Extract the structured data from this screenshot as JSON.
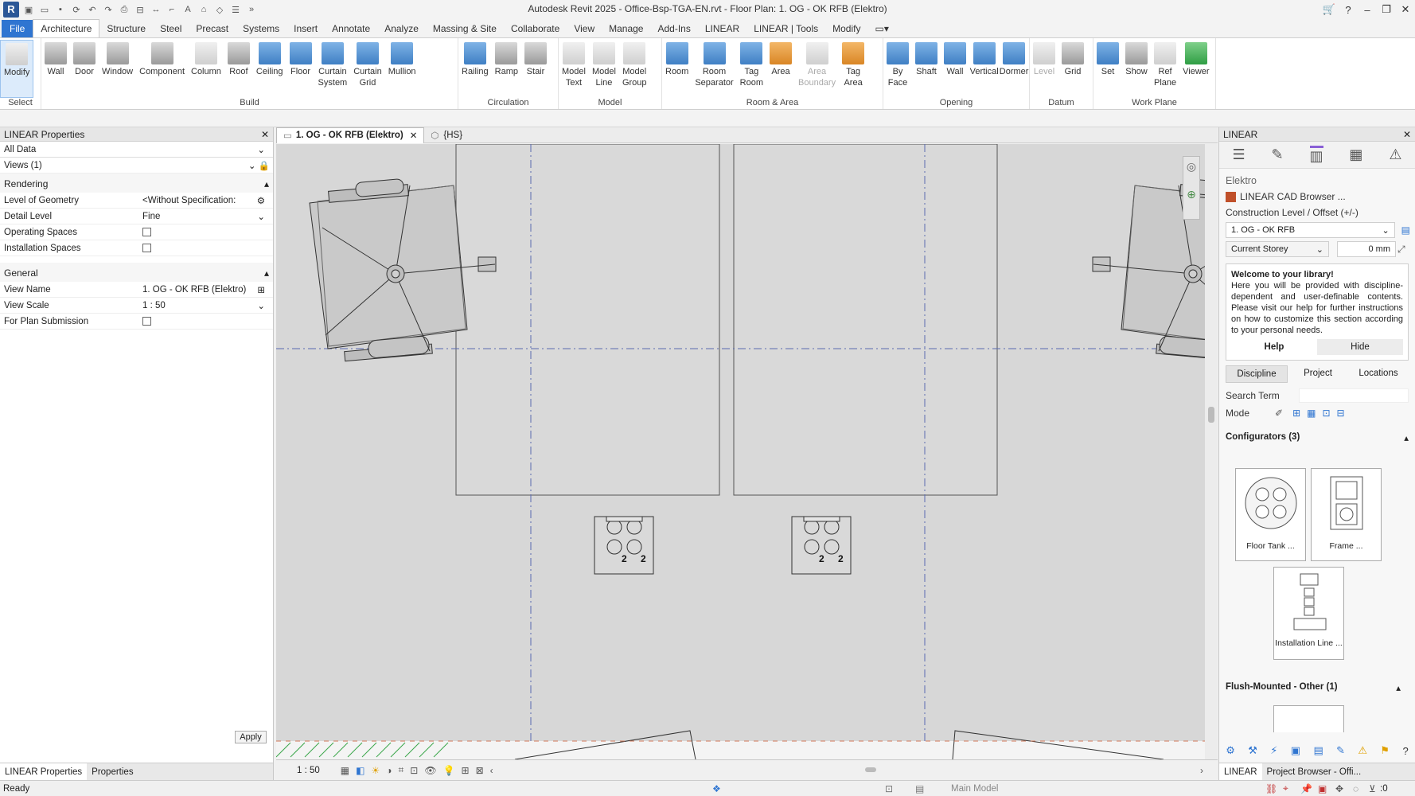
{
  "window": {
    "title": "Autodesk Revit 2025 - Office-Bsp-TGA-EN.rvt - Floor Plan: 1. OG - OK RFB (Elektro)"
  },
  "menu": [
    "File",
    "Architecture",
    "Structure",
    "Steel",
    "Precast",
    "Systems",
    "Insert",
    "Annotate",
    "Analyze",
    "Massing & Site",
    "Collaborate",
    "View",
    "Manage",
    "Add-Ins",
    "LINEAR",
    "LINEAR | Tools",
    "Modify"
  ],
  "ribbon": {
    "select_label": "Select",
    "modify": "Modify",
    "build": {
      "label": "Build",
      "tools": [
        "Wall",
        "Door",
        "Window",
        "Component",
        "Column",
        "Roof",
        "Ceiling",
        "Floor",
        "Curtain\nSystem",
        "Curtain\nGrid",
        "Mullion"
      ]
    },
    "circulation": {
      "label": "Circulation",
      "tools": [
        "Railing",
        "Ramp",
        "Stair"
      ]
    },
    "model": {
      "label": "Model",
      "tools": [
        "Model\nText",
        "Model\nLine",
        "Model\nGroup"
      ]
    },
    "roomarea": {
      "label": "Room & Area",
      "tools": [
        "Room",
        "Room\nSeparator",
        "Tag\nRoom",
        "Area",
        "Area\nBoundary",
        "Tag\nArea"
      ]
    },
    "opening": {
      "label": "Opening",
      "tools": [
        "By\nFace",
        "Shaft",
        "Wall",
        "Vertical",
        "Dormer"
      ]
    },
    "datum": {
      "label": "Datum",
      "tools": [
        "Level",
        "Grid"
      ]
    },
    "workplane": {
      "label": "Work Plane",
      "tools": [
        "Set",
        "Show",
        "Ref\nPlane",
        "Viewer"
      ]
    }
  },
  "properties": {
    "header": "LINEAR Properties",
    "filter": "All Data",
    "views": "Views (1)",
    "rendering_label": "Rendering",
    "level_of_geometry_k": "Level of Geometry",
    "level_of_geometry_v": "<Without Specification:",
    "detail_level_k": "Detail Level",
    "detail_level_v": "Fine",
    "operating_spaces": "Operating Spaces",
    "installation_spaces": "Installation Spaces",
    "general_label": "General",
    "view_name_k": "View Name",
    "view_name_v": "1. OG - OK RFB (Elektro)",
    "view_scale_k": "View Scale",
    "view_scale_v": "1 : 50",
    "plan_submission": "For Plan Submission",
    "apply": "Apply",
    "tab1": "LINEAR Properties",
    "tab2": "Properties"
  },
  "viewtabs": {
    "active": "1. OG - OK RFB (Elektro)",
    "other": "{HS}"
  },
  "canvas": {
    "tank_labels": [
      "2",
      "2"
    ]
  },
  "viewctl": {
    "scale": "1 : 50"
  },
  "linear": {
    "header": "LINEAR",
    "discipline": "Elektro",
    "cad_browser": "LINEAR CAD Browser ...",
    "level_label": "Construction Level / Offset (+/-)",
    "level_value": "1. OG - OK RFB",
    "storey": "Current Storey",
    "offset": "0 mm",
    "welcome_title": "Welcome to your library!",
    "welcome_text": "Here you will be provided with discipline-dependent and user-definable contents. Please visit our help for further instructions on how to customize this section according to your personal needs.",
    "help": "Help",
    "hide": "Hide",
    "tabs": [
      "Discipline",
      "Project",
      "Locations"
    ],
    "search_term": "Search Term",
    "mode": "Mode",
    "configurators": "Configurators (3)",
    "items": [
      "Floor Tank ...",
      "Frame ...",
      "Installation Line ..."
    ],
    "flush": "Flush-Mounted - Other (1)",
    "bottom1": "LINEAR",
    "bottom2": "Project Browser - Offi..."
  },
  "status": {
    "text": "Ready",
    "model": "Main Model",
    "filter": ":0"
  }
}
